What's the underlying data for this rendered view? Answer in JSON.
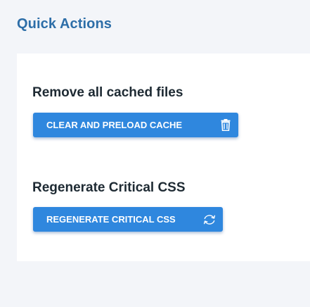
{
  "quick_actions": {
    "title": "Quick Actions"
  },
  "actions": [
    {
      "title": "Remove all cached files",
      "button_label": "CLEAR AND PRELOAD CACHE",
      "icon": "trash-icon"
    },
    {
      "title": "Regenerate Critical CSS",
      "button_label": "REGENERATE CRITICAL CSS",
      "icon": "refresh-icon"
    }
  ],
  "colors": {
    "accent": "#2f87de",
    "title": "#2d6ea8",
    "text": "#1e2a33",
    "page_background": "#f3f5f9",
    "panel_background": "#ffffff"
  }
}
